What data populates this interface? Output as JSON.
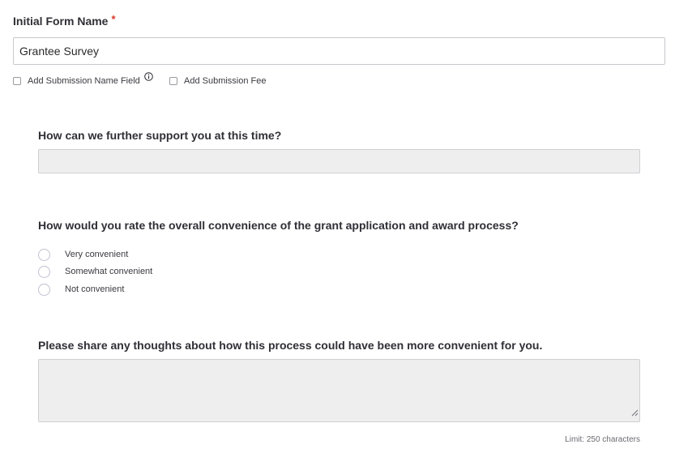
{
  "form_name": {
    "label": "Initial Form Name",
    "required_marker": "*",
    "value": "Grantee Survey"
  },
  "options": {
    "submission_name_field": {
      "label": "Add Submission Name Field",
      "checked": false,
      "info_icon": "info-icon"
    },
    "submission_fee": {
      "label": "Add Submission Fee",
      "checked": false
    }
  },
  "questions": [
    {
      "text": "How can we further support you at this time?",
      "type": "short-text",
      "value": ""
    },
    {
      "text": "How would you rate the overall convenience of the grant application and award process?",
      "type": "radio",
      "choices": [
        "Very convenient",
        "Somewhat convenient",
        "Not convenient"
      ]
    },
    {
      "text": "Please share any thoughts about how this process could have been more convenient for you.",
      "type": "long-text",
      "value": "",
      "limit_text": "Limit: 250 characters"
    }
  ],
  "colors": {
    "required": "#d93a2b",
    "disabled_field_bg": "#efeeef",
    "text": "#2f2f36"
  }
}
